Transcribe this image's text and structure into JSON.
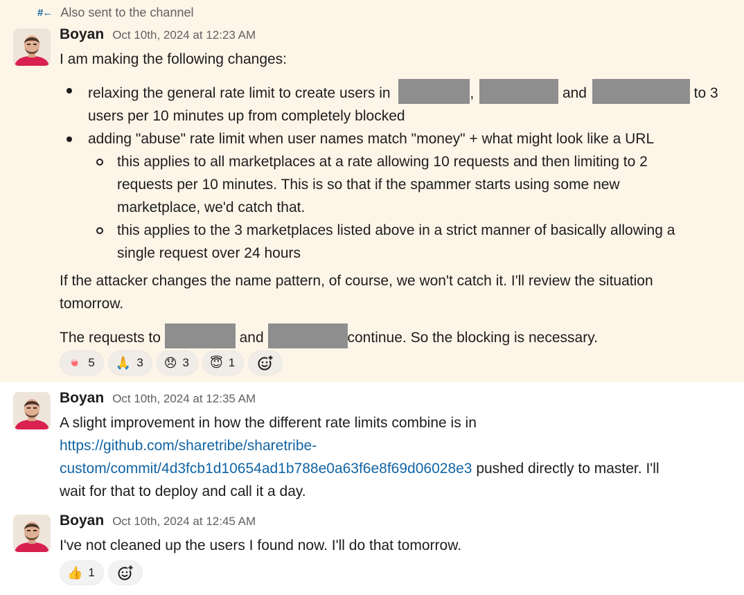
{
  "thread_banner": {
    "icon": "hash-arrow-icon",
    "icon_glyph": "#←",
    "text": "Also sent to the channel"
  },
  "messages": [
    {
      "author": "Boyan",
      "timestamp": "Oct 10th, 2024 at 12:23 AM",
      "intro": "I am making the following changes:",
      "bullet1": {
        "part1": "relaxing the general rate limit to create users in",
        "part2": ",",
        "part3": "and",
        "part4": "to 3",
        "line2": "users per 10 minutes up from completely blocked"
      },
      "bullet2": "adding \"abuse\" rate limit when user names match \"money\" + what might look like a URL",
      "sub1_lines": [
        "this applies to all marketplaces at a rate allowing 10 requests and then limiting to 2",
        "requests per 10 minutes. This is so that if the spammer starts using some new",
        "marketplace, we'd catch that."
      ],
      "sub2_lines": [
        "this applies to the 3 marketplaces listed above in a strict manner of basically allowing a",
        "single request over 24 hours"
      ],
      "para1_lines": [
        "If the attacker changes the name pattern, of course, we won't catch it. I'll review the situation",
        "tomorrow."
      ],
      "para2": {
        "part1": "The requests to",
        "part2": "and",
        "part3": "continue. So the blocking is necessary."
      },
      "reactions": [
        {
          "emoji": "🍬",
          "icon": "candy-emoji",
          "count": "5"
        },
        {
          "emoji": "🙏",
          "icon": "folded-hands-emoji",
          "count": "3"
        },
        {
          "emoji": "😞",
          "icon": "disappointed-face-emoji",
          "count": "3"
        },
        {
          "emoji": "😇",
          "icon": "halo-face-emoji",
          "count": "1"
        }
      ]
    },
    {
      "author": "Boyan",
      "timestamp": "Oct 10th, 2024 at 12:35 AM",
      "line1": "A slight improvement in how the different rate limits combine is in",
      "link_line1": "https://github.com/sharetribe/sharetribe-",
      "link_line2": "custom/commit/4d3fcb1d10654ad1b788e0a63f6e8f69d06028e3",
      "after_link": " pushed directly to master. I'll",
      "line4": "wait for that to deploy and call it a day."
    },
    {
      "author": "Boyan",
      "timestamp": "Oct 10th, 2024 at 12:45 AM",
      "text": "I've not cleaned up the users I found now. I'll do that tomorrow.",
      "reactions": [
        {
          "emoji": "👍",
          "icon": "thumbs-up-emoji",
          "count": "1"
        }
      ]
    }
  ],
  "add_reaction_icon": "add-reaction-icon",
  "colors": {
    "highlight_bg": "#fdf5e8",
    "link": "#1264a3",
    "redaction": "#8e8e8e",
    "muted": "#616061"
  }
}
